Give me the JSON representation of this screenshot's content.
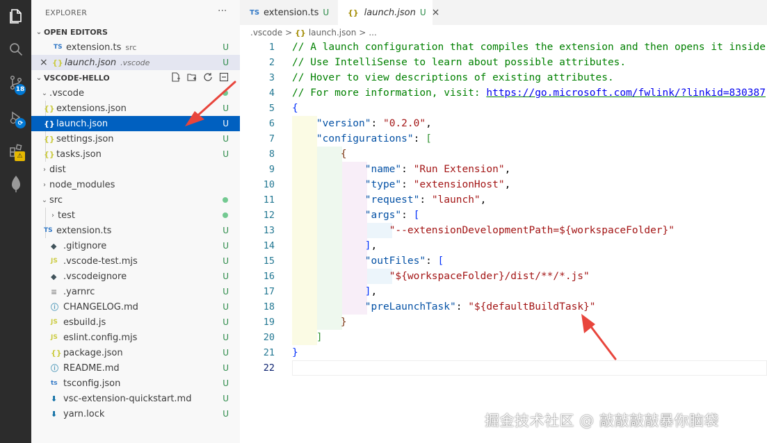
{
  "explorer": {
    "title": "EXPLORER",
    "more": "···",
    "open_editors": {
      "label": "OPEN EDITORS",
      "items": [
        {
          "icon": "TS",
          "name": "extension.ts",
          "hint": "src",
          "status": "U"
        },
        {
          "icon": "×",
          "icon2": "{}",
          "name": "launch.json",
          "hint": ".vscode",
          "status": "U"
        }
      ]
    },
    "workspace": {
      "label": "VSCODE-HELLO",
      "items": [
        {
          "chevron": "⌄",
          "icon": "",
          "name": ".vscode",
          "status": ""
        },
        {
          "icon": "{}",
          "name": "extensions.json",
          "status": "U"
        },
        {
          "icon": "{}",
          "name": "launch.json",
          "status": "U"
        },
        {
          "icon": "{}",
          "name": "settings.json",
          "status": "U"
        },
        {
          "icon": "{}",
          "name": "tasks.json",
          "status": "U"
        },
        {
          "chevron": "›",
          "icon": "",
          "name": "dist",
          "status": ""
        },
        {
          "chevron": "›",
          "icon": "",
          "name": "node_modules",
          "status": ""
        },
        {
          "chevron": "⌄",
          "icon": "",
          "name": "src",
          "status": ""
        },
        {
          "chevron": "›",
          "icon": "",
          "name": "test",
          "status": ""
        },
        {
          "icon": "TS",
          "name": "extension.ts",
          "status": "U"
        },
        {
          "icon": "◆",
          "name": ".gitignore",
          "status": "U"
        },
        {
          "icon": "JS",
          "name": ".vscode-test.mjs",
          "status": "U"
        },
        {
          "icon": "◆",
          "name": ".vscodeignore",
          "status": "U"
        },
        {
          "icon": "≡",
          "name": ".yarnrc",
          "status": "U"
        },
        {
          "icon": "ⓘ",
          "name": "CHANGELOG.md",
          "status": "U"
        },
        {
          "icon": "JS",
          "name": "esbuild.js",
          "status": "U"
        },
        {
          "icon": "JS",
          "name": "eslint.config.mjs",
          "status": "U"
        },
        {
          "icon": "{}",
          "name": "package.json",
          "status": "U"
        },
        {
          "icon": "ⓘ",
          "name": "README.md",
          "status": "U"
        },
        {
          "icon": "ts",
          "name": "tsconfig.json",
          "status": "U"
        },
        {
          "icon": "⬇",
          "name": "vsc-extension-quickstart.md",
          "status": "U"
        },
        {
          "icon": "⬇",
          "name": "yarn.lock",
          "status": "U"
        }
      ]
    }
  },
  "activity": {
    "scm_badge": "18"
  },
  "tabs": [
    {
      "icon": "TS",
      "label": "extension.ts",
      "status": "U"
    },
    {
      "icon": "{}",
      "label": "launch.json",
      "status": "U",
      "close": "×"
    }
  ],
  "breadcrumb": [
    ".vscode",
    ">",
    "{}",
    "launch.json",
    ">",
    "..."
  ],
  "editor": {
    "line_numbers": [
      "1",
      "2",
      "3",
      "4",
      "5",
      "6",
      "7",
      "8",
      "9",
      "10",
      "11",
      "12",
      "13",
      "14",
      "15",
      "16",
      "17",
      "18",
      "19",
      "20",
      "21",
      "22"
    ],
    "comments": [
      "// A launch configuration that compiles the extension and then opens it inside",
      "// Use IntelliSense to learn about possible attributes.",
      "// Hover to view descriptions of existing attributes.",
      "// For more information, visit: "
    ],
    "link": "https://go.microsoft.com/fwlink/?linkid=830387",
    "open_brace": "{",
    "close_brace": "}",
    "open_bracket": "[",
    "close_bracket": "]",
    "comma": ",",
    "colon": ": ",
    "keys": {
      "version": "\"version\"",
      "configurations": "\"configurations\"",
      "name": "\"name\"",
      "type": "\"type\"",
      "request": "\"request\"",
      "args": "\"args\"",
      "outFiles": "\"outFiles\"",
      "preLaunchTask": "\"preLaunchTask\""
    },
    "values": {
      "version": "\"0.2.0\"",
      "name": "\"Run Extension\"",
      "type": "\"extensionHost\"",
      "request": "\"launch\"",
      "args_item": "\"--extensionDevelopmentPath=${workspaceFolder}\"",
      "outFiles_item": "\"${workspaceFolder}/dist/**/*.js\"",
      "preLaunchTask": "\"${defaultBuildTask}\""
    }
  },
  "watermark": "掘金技术社区 @ 敲敲敲敲暴你脑袋",
  "colors": {
    "selection": "#0060c0",
    "activity_bar": "#2c2c2c",
    "sidebar": "#f8f8f8",
    "annotation": "#e8453c"
  }
}
